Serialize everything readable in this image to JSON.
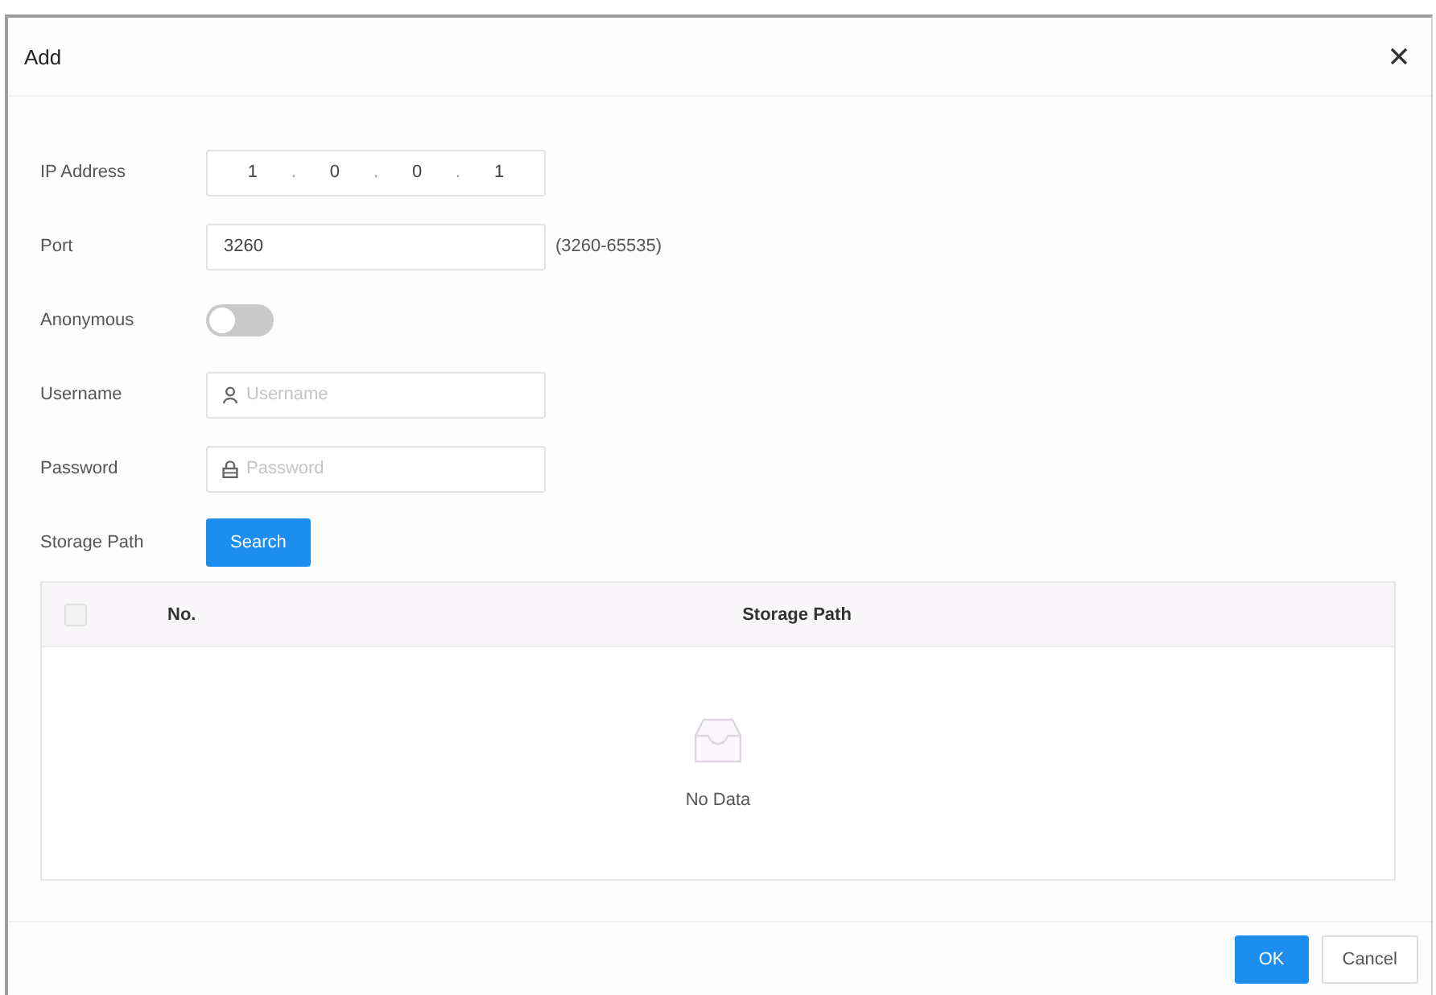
{
  "dialog": {
    "title": "Add"
  },
  "fields": [
    {
      "kind": "ip",
      "label": "IP Address",
      "octets": [
        "1",
        "0",
        "0",
        "1"
      ],
      "separator": "."
    },
    {
      "kind": "text",
      "label": "Port",
      "value": "3260",
      "hint": "(3260-65535)"
    },
    {
      "kind": "toggle",
      "label": "Anonymous",
      "on": false
    },
    {
      "kind": "username",
      "label": "Username",
      "placeholder": "Username"
    },
    {
      "kind": "password",
      "label": "Password",
      "placeholder": "Password"
    },
    {
      "kind": "action",
      "label": "Storage Path",
      "button": "Search"
    }
  ],
  "table": {
    "columns": [
      {
        "kind": "checkbox",
        "checked": false
      },
      {
        "kind": "text",
        "label": "No."
      },
      {
        "kind": "text",
        "label": "Storage Path"
      }
    ],
    "empty_text": "No Data"
  },
  "footer": {
    "buttons": [
      {
        "label": "OK",
        "kind": "primary"
      },
      {
        "label": "Cancel",
        "kind": "default"
      }
    ]
  }
}
